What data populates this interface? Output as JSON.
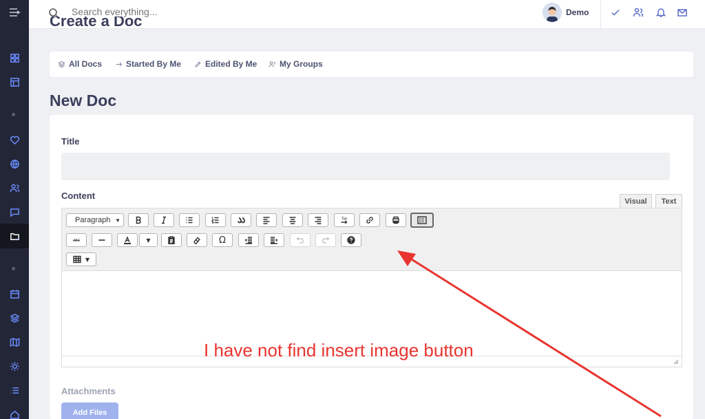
{
  "search": {
    "placeholder": "Search everything..."
  },
  "user": {
    "name": "Demo"
  },
  "page": {
    "heading_cut": "Create a Doc",
    "title": "New Doc"
  },
  "doc_tabs": [
    "All Docs",
    "Started By Me",
    "Edited By Me",
    "My Groups"
  ],
  "form": {
    "title_label": "Title",
    "content_label": "Content",
    "attachments_label": "Attachments",
    "add_files_label": "Add Files"
  },
  "editor": {
    "mode_tabs": [
      "Visual",
      "Text"
    ],
    "format_select": "Paragraph",
    "row1": [
      "bold",
      "italic",
      "bullet-list",
      "numbered-list",
      "blockquote",
      "align-left",
      "align-center",
      "align-right",
      "tab",
      "link",
      "print",
      "toolbar-toggle"
    ],
    "row2": [
      "strikethrough-spellcheck",
      "horizontal-line",
      "text-color",
      "text-color-dropdown",
      "paste-as-text",
      "clear-formatting",
      "special-character",
      "outdent",
      "indent",
      "undo",
      "redo",
      "help"
    ],
    "row3": [
      "table"
    ]
  },
  "annotation": {
    "text": "I have not find insert image button",
    "color": "#e8352f"
  },
  "colors": {
    "sidebar": "#232637",
    "accent": "#6b8cff",
    "button": "#9fb2ee"
  }
}
